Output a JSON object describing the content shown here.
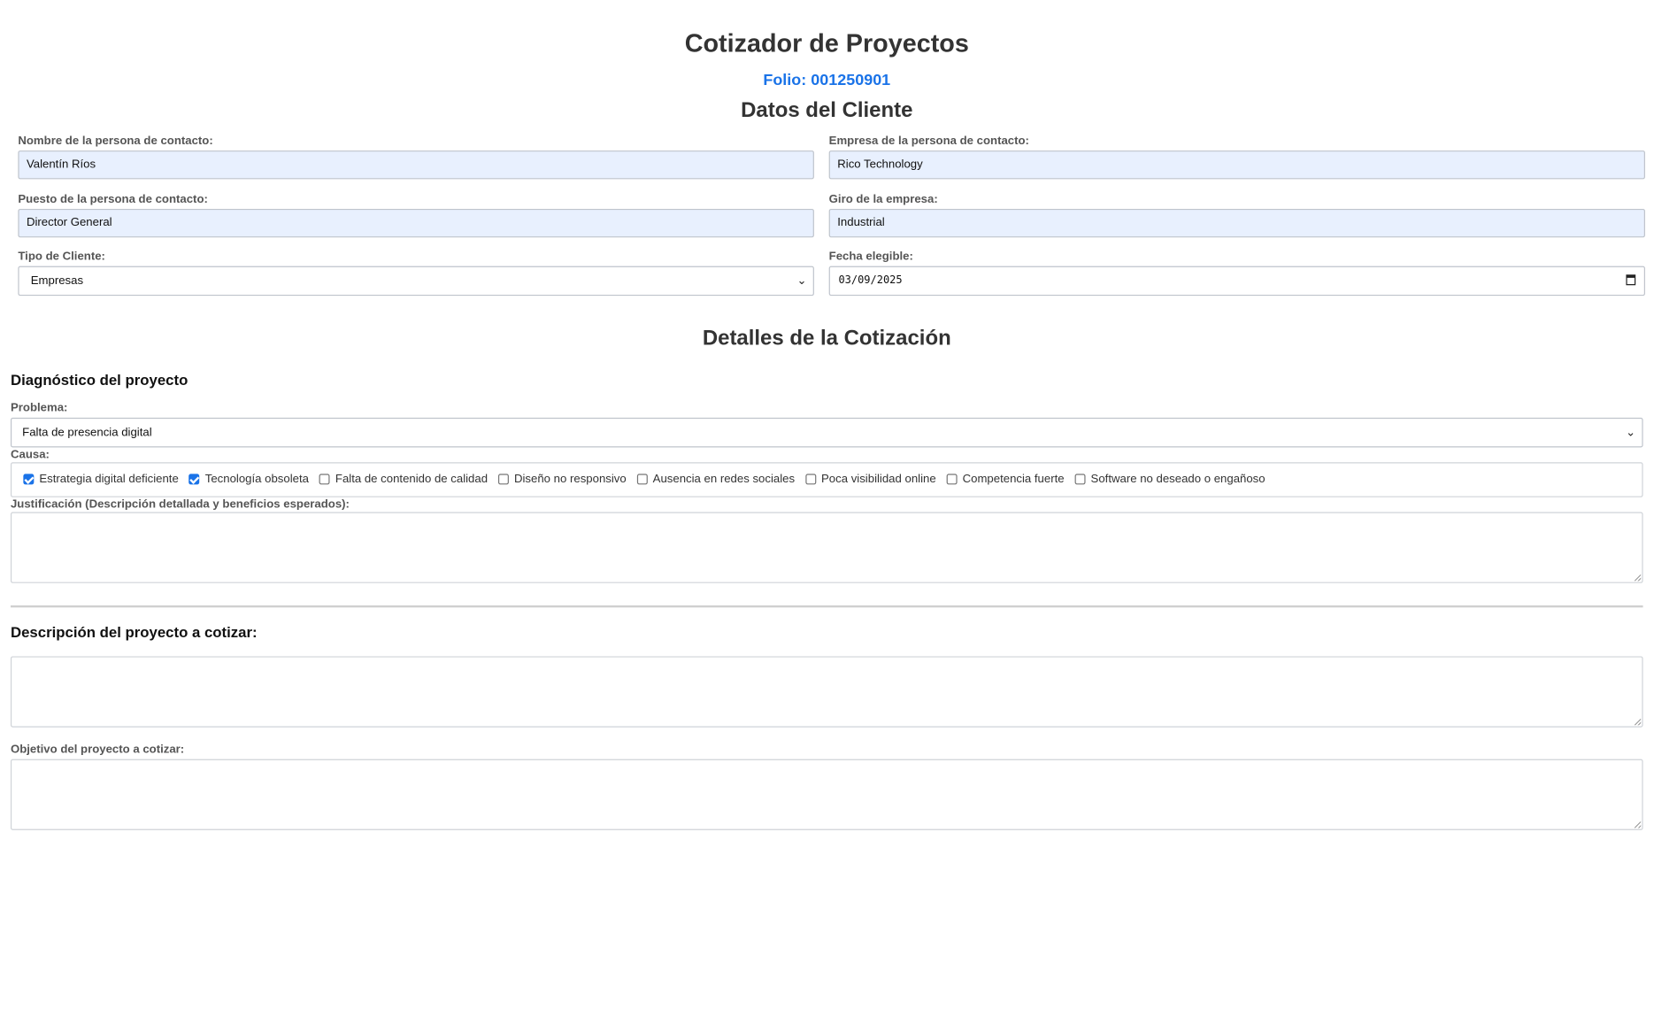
{
  "header": {
    "title": "Cotizador de Proyectos",
    "folio": "Folio: 001250901"
  },
  "cliente": {
    "section_title": "Datos del Cliente",
    "nombre": {
      "label": "Nombre de la persona de contacto:",
      "value": "Valentín Ríos"
    },
    "empresa": {
      "label": "Empresa de la persona de contacto:",
      "value": "Rico Technology"
    },
    "puesto": {
      "label": "Puesto de la persona de contacto:",
      "value": "Director General"
    },
    "giro": {
      "label": "Giro de la empresa:",
      "value": "Industrial"
    },
    "tipo": {
      "label": "Tipo de Cliente:",
      "value": "Empresas"
    },
    "fecha": {
      "label": "Fecha elegible:",
      "value": "03/09/2025"
    }
  },
  "cotizacion": {
    "section_title": "Detalles de la Cotización",
    "diagnostico_title": "Diagnóstico del proyecto",
    "problema": {
      "label": "Problema:",
      "value": "Falta de presencia digital"
    },
    "causa": {
      "label": "Causa:",
      "options": [
        {
          "label": "Estrategia digital deficiente",
          "checked": true
        },
        {
          "label": "Tecnología obsoleta",
          "checked": true
        },
        {
          "label": "Falta de contenido de calidad",
          "checked": false
        },
        {
          "label": "Diseño no responsivo",
          "checked": false
        },
        {
          "label": "Ausencia en redes sociales",
          "checked": false
        },
        {
          "label": "Poca visibilidad online",
          "checked": false
        },
        {
          "label": "Competencia fuerte",
          "checked": false
        },
        {
          "label": "Software no deseado o engañoso",
          "checked": false
        }
      ]
    },
    "justificacion": {
      "label": "Justificación (Descripción detallada y beneficios esperados):",
      "value": ""
    },
    "descripcion_title": "Descripción del proyecto a cotizar:",
    "descripcion": {
      "value": ""
    },
    "objetivo": {
      "label": "Objetivo del proyecto a cotizar:",
      "value": ""
    }
  },
  "icons": {
    "select_arrow": "chevron-down-icon",
    "date_picker": "calendar-icon",
    "checkbox": "check-icon",
    "resize": "resize-handle-icon"
  },
  "colors": {
    "folio": "#1a73e8",
    "autofill_bg": "#e8f0fe",
    "checkbox_checked": "#1a73e8"
  }
}
